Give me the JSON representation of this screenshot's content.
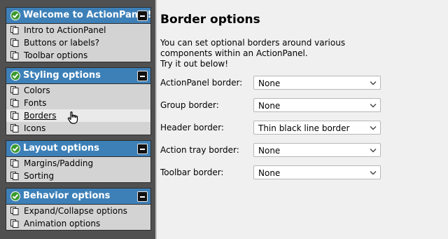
{
  "sidebar": {
    "groups": [
      {
        "title": "Welcome to ActionPanel!",
        "items": [
          {
            "label": "Intro to ActionPanel"
          },
          {
            "label": "Buttons or labels?"
          },
          {
            "label": "Toolbar options"
          }
        ]
      },
      {
        "title": "Styling options",
        "items": [
          {
            "label": "Colors"
          },
          {
            "label": "Fonts"
          },
          {
            "label": "Borders"
          },
          {
            "label": "Icons"
          }
        ]
      },
      {
        "title": "Layout options",
        "items": [
          {
            "label": "Margins/Padding"
          },
          {
            "label": "Sorting"
          }
        ]
      },
      {
        "title": "Behavior options",
        "items": [
          {
            "label": "Expand/Collapse options"
          },
          {
            "label": "Animation options"
          }
        ]
      }
    ],
    "selected_item": "Borders"
  },
  "main": {
    "title": "Border options",
    "description": [
      "You can set optional borders around various",
      "components within an ActionPanel.",
      "Try it out below!"
    ],
    "rows": [
      {
        "label": "ActionPanel border:",
        "value": "None"
      },
      {
        "label": "Group border:",
        "value": "None"
      },
      {
        "label": "Header border:",
        "value": "Thin black line border"
      },
      {
        "label": "Action tray border:",
        "value": "None"
      },
      {
        "label": "Toolbar border:",
        "value": "None"
      }
    ]
  },
  "colors": {
    "header_blue": "#3d80b8",
    "sidebar_bg": "#505050",
    "item_bg": "#d3d3d3",
    "check_green": "#3a9a2e"
  },
  "icons": {
    "group_header": "check-icon",
    "group_toggle": "collapse-icon",
    "item": "copy-icon",
    "select": "chevron-down-icon",
    "cursor": "hand-cursor-icon"
  }
}
